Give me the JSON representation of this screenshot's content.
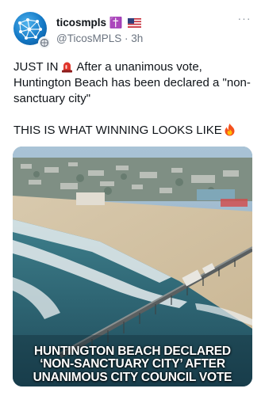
{
  "author": {
    "display_name": "ticosmpls ✝️",
    "handle": "@TicosMPLS",
    "separator": "·",
    "time": "3h"
  },
  "menu": {
    "more_label": "···"
  },
  "post": {
    "line1_prefix": "JUST IN",
    "line1_suffix": "After a unanimous vote,",
    "line2": "Huntington Beach has been declared a \"non-",
    "line3": "sanctuary city\"",
    "line4": "THIS IS WHAT WINNING LOOKS LIKE"
  },
  "media": {
    "caption_line1": "HUNTINGTON BEACH DECLARED",
    "caption_line2": "‘NON-SANCTUARY CITY’ AFTER",
    "caption_line3": "UNANIMOUS CITY COUNCIL VOTE"
  },
  "icons": {
    "avatar": "globe-network-icon",
    "badge": "verified-badge-icon",
    "flag": "us-flag-icon",
    "siren": "rotating-light-icon",
    "fire": "fire-icon",
    "more": "more-options-icon"
  },
  "colors": {
    "text": "#0f1419",
    "secondary": "#6b7480",
    "avatar_blue": "#1479c6"
  }
}
